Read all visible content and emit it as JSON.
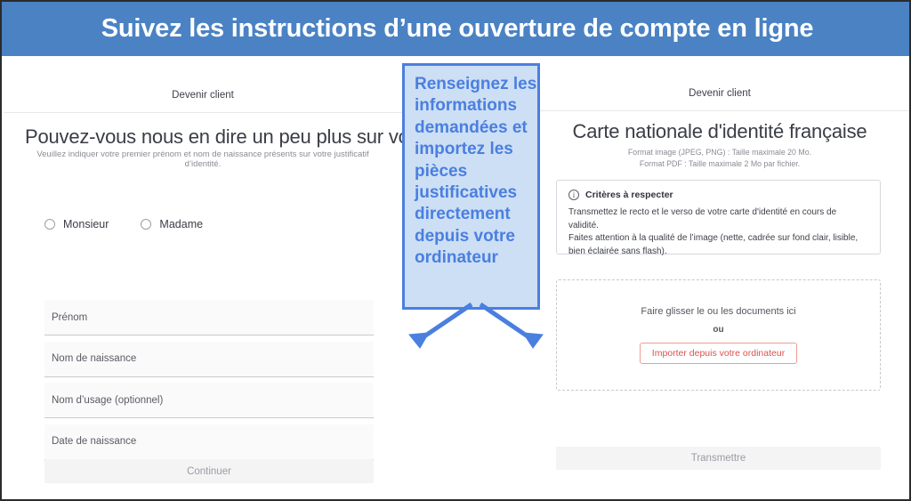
{
  "banner": {
    "title": "Suivez les instructions d’une ouverture de compte en ligne",
    "background": "#4a82c4",
    "text_color": "#ffffff"
  },
  "left_panel": {
    "topbar_label": "Devenir client",
    "heading": "Pouvez-vous nous en dire un peu plus sur vous ?",
    "subtitle": "Veuillez indiquer votre premier prénom et nom de naissance présents sur votre justificatif d’identité.",
    "radio_options": [
      {
        "label": "Monsieur",
        "selected": false
      },
      {
        "label": "Madame",
        "selected": false
      }
    ],
    "fields": [
      {
        "label": "Prénom",
        "value": ""
      },
      {
        "label": "Nom de naissance",
        "value": ""
      },
      {
        "label": "Nom d’usage (optionnel)",
        "value": ""
      },
      {
        "label": "Date de naissance",
        "value": ""
      }
    ],
    "submit_label": "Continuer"
  },
  "callout": {
    "text": "Renseignez les informations demandées et importez les pièces justificatives directement depuis votre ordinateur",
    "fill_color": "#cddff4",
    "border_color": "#4a7fe0",
    "text_color": "#4a7fe0",
    "arrow_color": "#4a7fe0"
  },
  "right_panel": {
    "topbar_label": "Devenir client",
    "heading": "Carte nationale d'identité française",
    "subtitle_line1": "Format image (JPEG, PNG) : Taille maximale 20 Mo.",
    "subtitle_line2": "Format PDF : Taille maximale 2 Mo par fichier.",
    "criteria": {
      "icon": "info-circle-icon",
      "title": "Critères à respecter",
      "line1": "Transmettez le recto et le verso de votre carte d'identité en cours de validité.",
      "line2": "Faites attention à la qualité de l’image (nette, cadrée sur fond clair, lisible, bien éclairée sans flash)."
    },
    "dropzone": {
      "prompt": "Faire glisser le ou les documents ici",
      "or": "ou",
      "import_label": "Importer depuis votre ordinateur",
      "import_color": "#d9534f"
    },
    "submit_label": "Transmettre"
  }
}
